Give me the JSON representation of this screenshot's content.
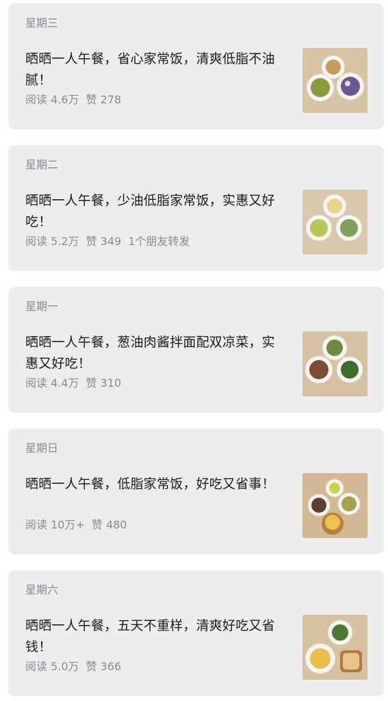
{
  "cards": [
    {
      "day": "星期三",
      "title": "晒晒一人午餐，省心家常饭，清爽低脂不油腻！",
      "reads": "阅读 4.6万",
      "likes": "赞 278",
      "shares": "",
      "thumb_icon": "lunch-plates-photo"
    },
    {
      "day": "星期二",
      "title": "晒晒一人午餐，少油低脂家常饭，实惠又好吃！",
      "reads": "阅读 5.2万",
      "likes": "赞 349",
      "shares": "1个朋友转发",
      "thumb_icon": "lunch-plates-photo"
    },
    {
      "day": "星期一",
      "title": "晒晒一人午餐，葱油肉酱拌面配双凉菜，实惠又好吃！",
      "reads": "阅读 4.4万",
      "likes": "赞 310",
      "shares": "",
      "thumb_icon": "lunch-plates-photo"
    },
    {
      "day": "星期日",
      "title": "晒晒一人午餐，低脂家常饭，好吃又省事！",
      "reads": "阅读 10万+",
      "likes": "赞 480",
      "shares": "",
      "thumb_icon": "lunch-plates-photo"
    },
    {
      "day": "星期六",
      "title": "晒晒一人午餐，五天不重样，清爽好吃又省钱！",
      "reads": "阅读 5.0万",
      "likes": "赞 366",
      "shares": "",
      "thumb_icon": "lunch-plates-photo"
    }
  ]
}
